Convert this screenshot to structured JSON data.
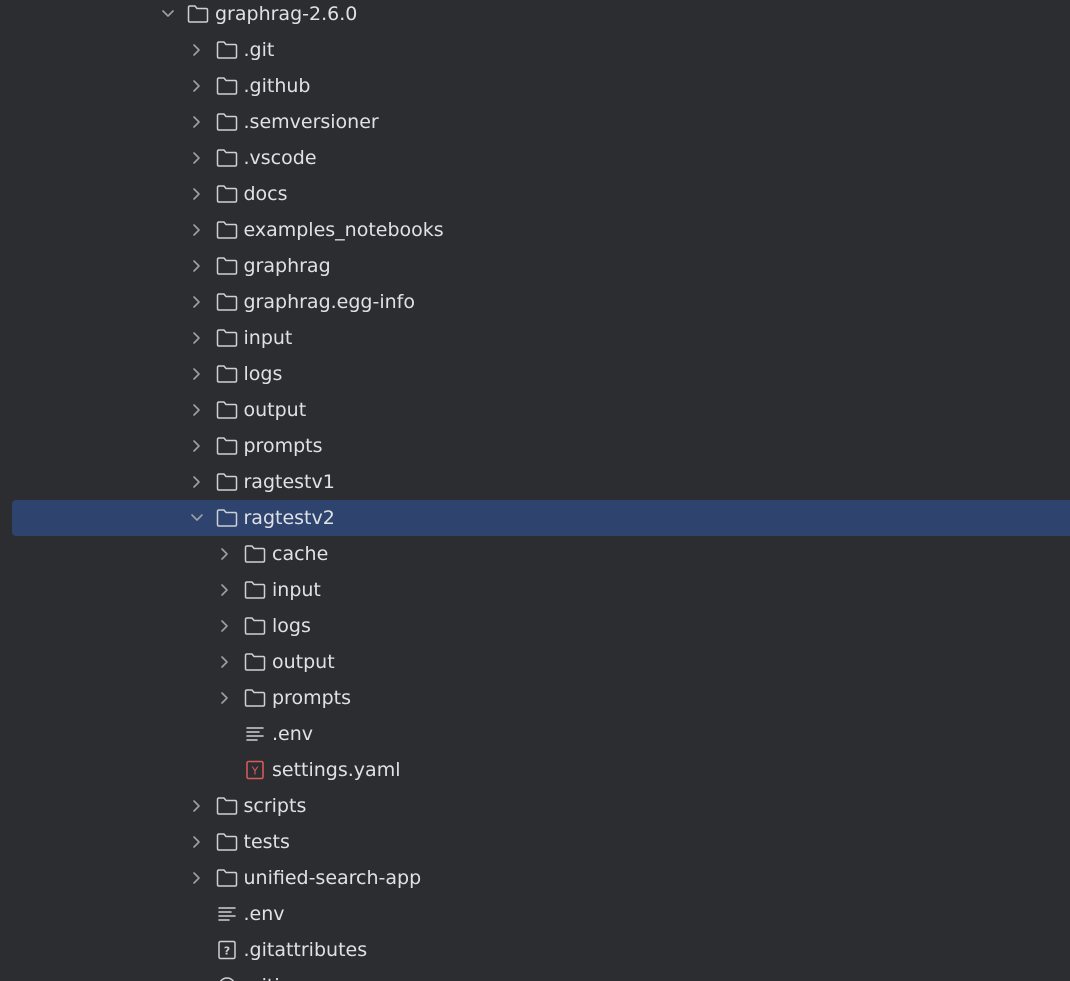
{
  "tree": {
    "items": [
      {
        "label": "graphrag-2.6.0",
        "type": "folder",
        "depth": 0,
        "expanded": true
      },
      {
        "label": ".git",
        "type": "folder",
        "depth": 1,
        "expanded": false
      },
      {
        "label": ".github",
        "type": "folder",
        "depth": 1,
        "expanded": false
      },
      {
        "label": ".semversioner",
        "type": "folder",
        "depth": 1,
        "expanded": false
      },
      {
        "label": ".vscode",
        "type": "folder",
        "depth": 1,
        "expanded": false
      },
      {
        "label": "docs",
        "type": "folder",
        "depth": 1,
        "expanded": false
      },
      {
        "label": "examples_notebooks",
        "type": "folder",
        "depth": 1,
        "expanded": false
      },
      {
        "label": "graphrag",
        "type": "folder",
        "depth": 1,
        "expanded": false
      },
      {
        "label": "graphrag.egg-info",
        "type": "folder",
        "depth": 1,
        "expanded": false
      },
      {
        "label": "input",
        "type": "folder",
        "depth": 1,
        "expanded": false
      },
      {
        "label": "logs",
        "type": "folder",
        "depth": 1,
        "expanded": false
      },
      {
        "label": "output",
        "type": "folder",
        "depth": 1,
        "expanded": false
      },
      {
        "label": "prompts",
        "type": "folder",
        "depth": 1,
        "expanded": false
      },
      {
        "label": "ragtestv1",
        "type": "folder",
        "depth": 1,
        "expanded": false
      },
      {
        "label": "ragtestv2",
        "type": "folder",
        "depth": 1,
        "expanded": true,
        "selected": true
      },
      {
        "label": "cache",
        "type": "folder",
        "depth": 2,
        "expanded": false
      },
      {
        "label": "input",
        "type": "folder",
        "depth": 2,
        "expanded": false
      },
      {
        "label": "logs",
        "type": "folder",
        "depth": 2,
        "expanded": false
      },
      {
        "label": "output",
        "type": "folder",
        "depth": 2,
        "expanded": false
      },
      {
        "label": "prompts",
        "type": "folder",
        "depth": 2,
        "expanded": false
      },
      {
        "label": ".env",
        "type": "text-file",
        "depth": 2
      },
      {
        "label": "settings.yaml",
        "type": "yaml-file",
        "depth": 2
      },
      {
        "label": "scripts",
        "type": "folder",
        "depth": 1,
        "expanded": false
      },
      {
        "label": "tests",
        "type": "folder",
        "depth": 1,
        "expanded": false
      },
      {
        "label": "unified-search-app",
        "type": "folder",
        "depth": 1,
        "expanded": false
      },
      {
        "label": ".env",
        "type": "text-file",
        "depth": 1
      },
      {
        "label": ".gitattributes",
        "type": "unknown-file",
        "depth": 1
      },
      {
        "label": ".gitignore",
        "type": "git-file",
        "depth": 1
      }
    ]
  },
  "colors": {
    "background": "#2b2d30",
    "selection": "#2e436e",
    "text": "#dfe1e5",
    "icon": "#ced0d6",
    "chevron": "#9da0a8",
    "yaml_accent": "#db5c5c"
  },
  "icons": {
    "folder": "folder-icon",
    "text-file": "text-file-icon",
    "yaml-file": "yaml-file-icon",
    "unknown-file": "unknown-file-icon",
    "git-file": "git-file-icon",
    "chevron-right": "chevron-right-icon",
    "chevron-down": "chevron-down-icon"
  },
  "yaml_badge": "Y",
  "unknown_badge": "?"
}
